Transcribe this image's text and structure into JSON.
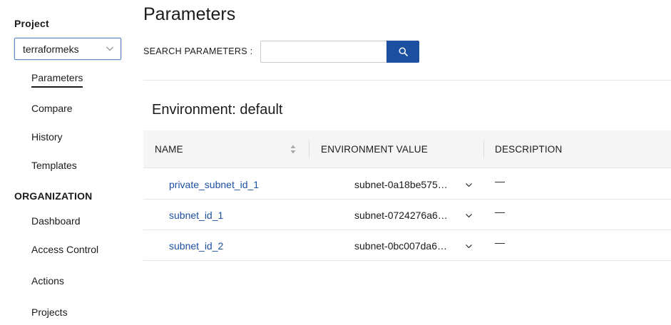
{
  "sidebar": {
    "project_heading": "Project",
    "project_selected": "terraformeks",
    "project_items": [
      {
        "label": "Parameters"
      },
      {
        "label": "Compare"
      },
      {
        "label": "History"
      },
      {
        "label": "Templates"
      }
    ],
    "org_heading": "ORGANIZATION",
    "org_items": [
      {
        "label": "Dashboard"
      },
      {
        "label": "Access Control"
      },
      {
        "label": "Actions"
      },
      {
        "label": "Projects"
      }
    ]
  },
  "main": {
    "title": "Parameters",
    "search_label": "SEARCH PARAMETERS :",
    "search_value": "",
    "environment_title": "Environment: default",
    "columns": [
      "NAME",
      "ENVIRONMENT VALUE",
      "DESCRIPTION"
    ],
    "rows": [
      {
        "name": "private_subnet_id_1",
        "value": "subnet-0a18be575…",
        "description": "—"
      },
      {
        "name": "subnet_id_1",
        "value": "subnet-0724276a6…",
        "description": "—"
      },
      {
        "name": "subnet_id_2",
        "value": "subnet-0bc007da6…",
        "description": "—"
      }
    ]
  },
  "colors": {
    "accent": "#1d4fa0",
    "header_bg": "#f5f5f5",
    "link": "#1d4fa0"
  },
  "icons": {
    "search": "search-icon",
    "dropdown": "chevron-down-icon",
    "sort": "sort-icon"
  }
}
